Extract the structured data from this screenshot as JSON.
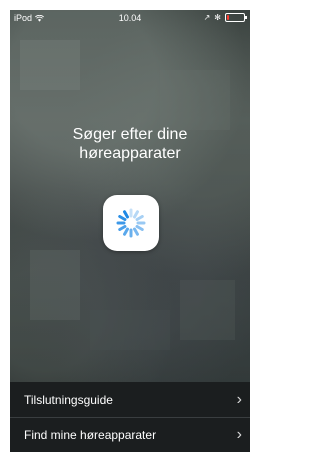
{
  "status_bar": {
    "device": "iPod",
    "time": "10.04",
    "location_arrow": "↗",
    "bluetooth": "✻",
    "battery_level": 0.15,
    "battery_color": "#ff3b30"
  },
  "search": {
    "line1": "Søger efter dine",
    "line2": "høreapparater",
    "spinner_color": "#1e88e5"
  },
  "menu": [
    {
      "label": "Tilslutningsguide"
    },
    {
      "label": "Find mine høreapparater"
    }
  ]
}
